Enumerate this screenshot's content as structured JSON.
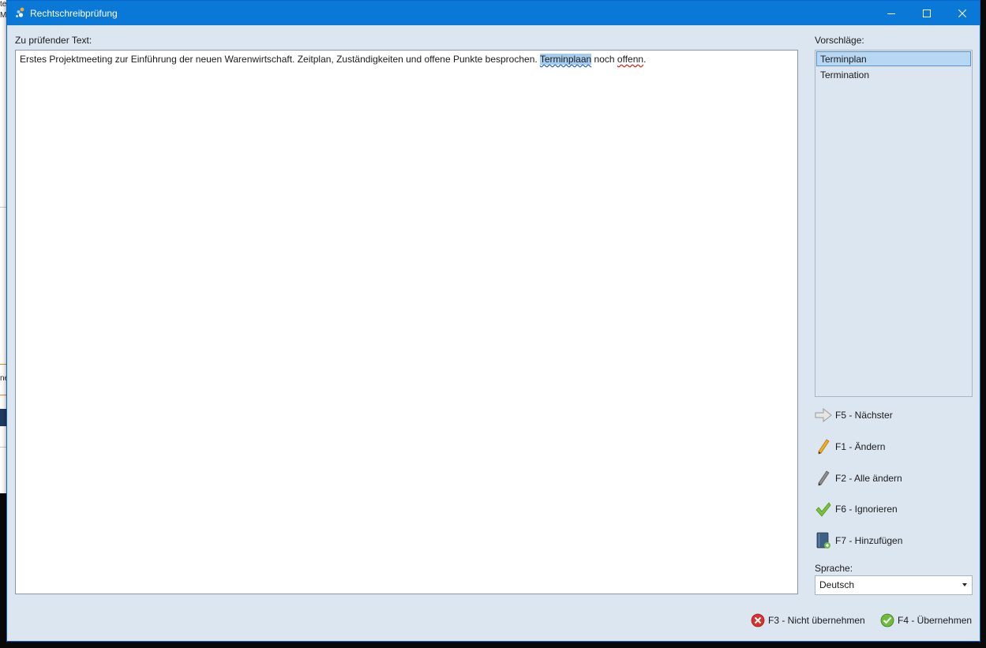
{
  "window": {
    "title": "Rechtschreibprüfung",
    "accent": "#0a78d7",
    "background": "#dce6f1"
  },
  "background_app": {
    "fragments": [
      "te",
      "Mı",
      "ne"
    ]
  },
  "controls": {
    "minimize_icon": "minimize-icon",
    "maximize_icon": "maximize-icon",
    "close_icon": "close-icon"
  },
  "text_area": {
    "label": "Zu prüfender Text:",
    "before": "Erstes Projektmeeting zur Einführung der neuen Warenwirtschaft. Zeitplan, Zuständigkeiten und offene Punkte besprochen. ",
    "highlighted_word": "Terminplaan",
    "between": " noch ",
    "error_word": "offenn",
    "after": "."
  },
  "suggestions": {
    "label": "Vorschläge:",
    "items": [
      "Terminplan",
      "Termination"
    ],
    "selected": "Terminplan"
  },
  "actions": {
    "next": "F5 - Nächster",
    "change": "F1 - Ändern",
    "change_all": "F2 - Alle ändern",
    "ignore": "F6 - Ignorieren",
    "add": "F7 - Hinzufügen"
  },
  "language": {
    "label": "Sprache:",
    "value": "Deutsch"
  },
  "footer": {
    "cancel": "F3 - Nicht übernehmen",
    "accept": "F4 - Übernehmen"
  }
}
